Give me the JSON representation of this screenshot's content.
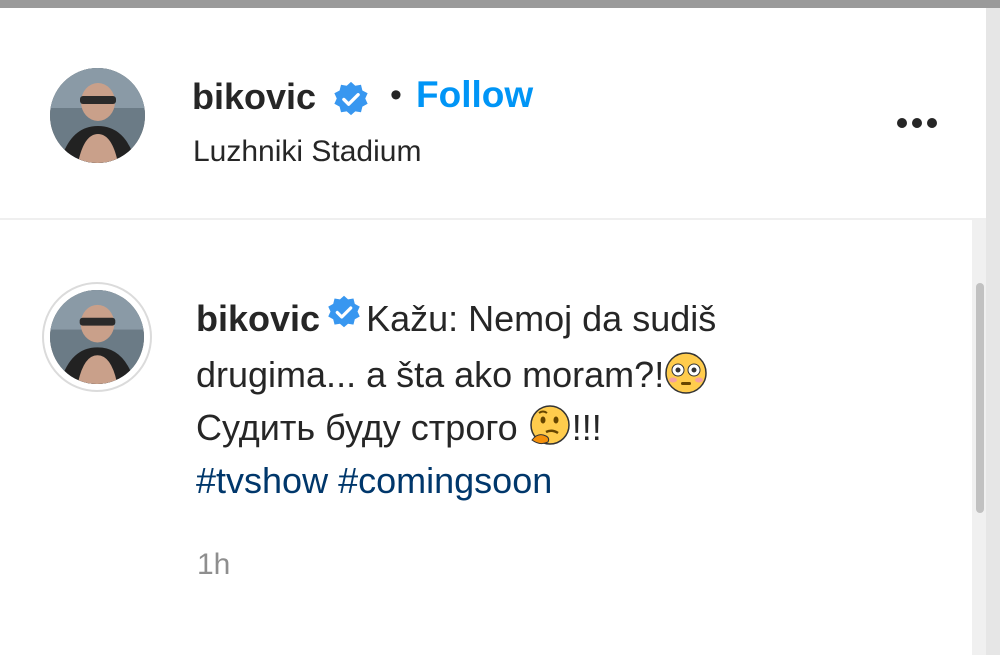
{
  "header": {
    "username": "bikovic",
    "separator": "•",
    "follow_label": "Follow",
    "location": "Luzhniki Stadium"
  },
  "icons": {
    "verified": "verified-badge-icon",
    "more": "more-options-icon",
    "emoji_flushed": "flushed-face-emoji",
    "emoji_thinking": "thinking-face-emoji"
  },
  "comment": {
    "username": "bikovic",
    "text_line1": "Kažu: Nemoj da sudiš",
    "text_line2": "drugima... a šta ako moram?!",
    "text_line3": "Судить буду строго ",
    "text_line3_suffix": "!!!",
    "hashtags": [
      "#tvshow",
      "#comingsoon"
    ],
    "time": "1h"
  },
  "colors": {
    "accent": "#0095f6",
    "verified": "#3897f0",
    "hashtag": "#00376b",
    "muted": "#8e8e8e"
  }
}
